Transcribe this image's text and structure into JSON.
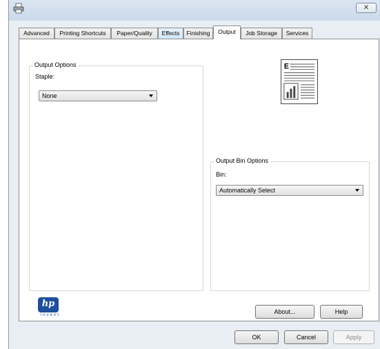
{
  "window": {
    "close_glyph": "✕",
    "app_icon": "printer-icon"
  },
  "tabs": [
    {
      "label": "Advanced"
    },
    {
      "label": "Printing Shortcuts"
    },
    {
      "label": "Paper/Quality"
    },
    {
      "label": "Effects"
    },
    {
      "label": "Finishing"
    },
    {
      "label": "Output"
    },
    {
      "label": "Job Storage"
    },
    {
      "label": "Services"
    }
  ],
  "active_tab": "Output",
  "output_options": {
    "legend": "Output Options",
    "staple_label": "Staple:",
    "staple_value": "None"
  },
  "output_bin_options": {
    "legend": "Output Bin Options",
    "bin_label": "Bin:",
    "bin_value": "Automatically Select"
  },
  "preview": {
    "letter": "E",
    "icon": "document-preview-icon"
  },
  "brand": {
    "logo_text": "hp",
    "tagline": "invent",
    "color": "#1c4f9c"
  },
  "buttons": {
    "about": "About...",
    "help": "Help",
    "ok": "OK",
    "cancel": "Cancel",
    "apply": "Apply"
  }
}
